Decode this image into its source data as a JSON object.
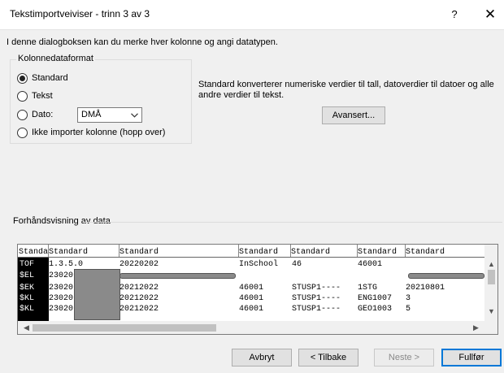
{
  "window": {
    "title": "Tekstimportveiviser - trinn 3 av 3",
    "help_label": "?",
    "close_label": "✕"
  },
  "intro_text": "I denne dialogboksen kan du merke hver kolonne og angi datatypen.",
  "column_format": {
    "legend": "Kolonnedataformat",
    "options": [
      {
        "label": "Standard",
        "selected": true
      },
      {
        "label": "Tekst",
        "selected": false
      },
      {
        "label": "Dato:",
        "selected": false
      },
      {
        "label": "Ikke importer kolonne (hopp over)",
        "selected": false
      }
    ],
    "date_format_value": "DMÅ"
  },
  "description": "Standard konverterer numeriske verdier til tall, datoverdier til datoer og alle andre verdier til tekst.",
  "advanced_button": "Avansert...",
  "preview": {
    "label": "Forhåndsvisning av data",
    "headers": [
      "Standard",
      "Standard",
      "Standard",
      "Standard",
      "Standard",
      "Standard",
      "Standard"
    ],
    "rows": [
      [
        "TOF",
        "1.3.5.0",
        "20220202",
        "InSchool",
        "46",
        "46001",
        ""
      ],
      [
        "$EL",
        "23020",
        "",
        "",
        "",
        "",
        ""
      ],
      [
        "$EK",
        "23020",
        "20212022",
        "46001",
        "STUSP1----",
        "1STG",
        "20210801"
      ],
      [
        "$KL",
        "23020",
        "20212022",
        "46001",
        "STUSP1----",
        "ENG1007",
        "3"
      ],
      [
        "$KL",
        "23020",
        "20212022",
        "46001",
        "STUSP1----",
        "GEO1003",
        "5"
      ]
    ]
  },
  "buttons": {
    "cancel": "Avbryt",
    "back": "< Tilbake",
    "next": "Neste >",
    "finish": "Fullfør"
  }
}
